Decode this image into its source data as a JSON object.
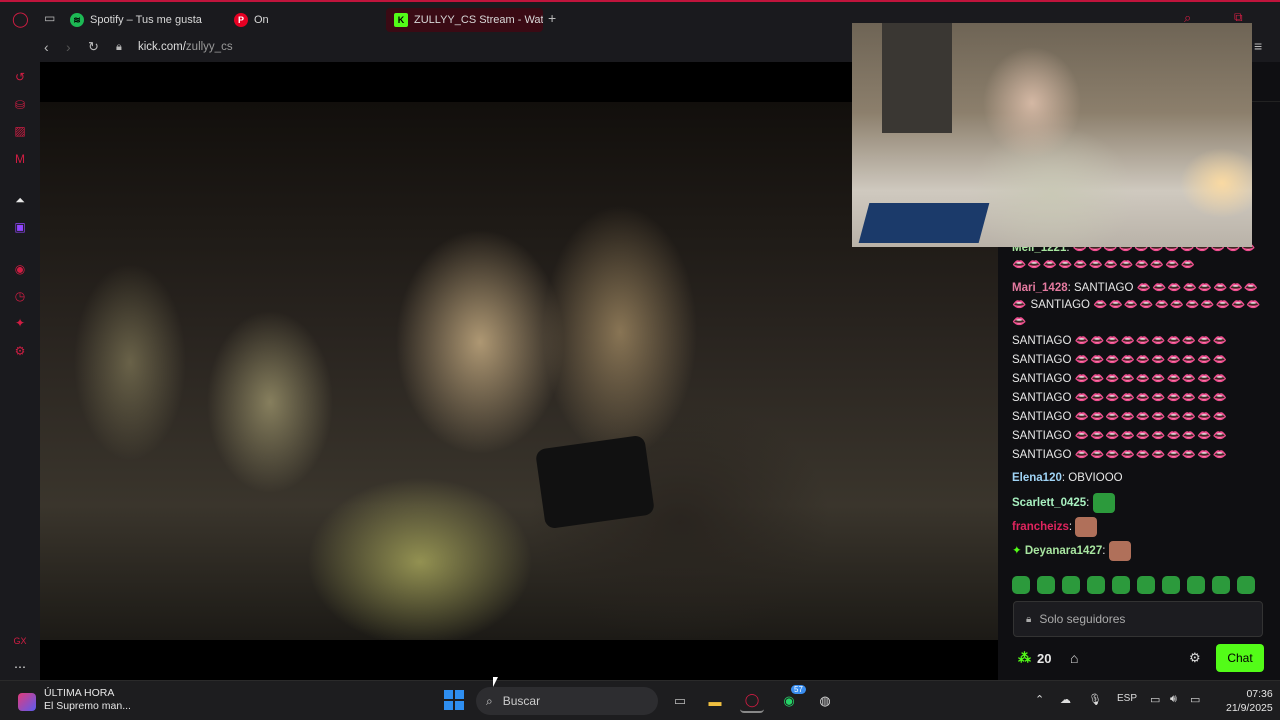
{
  "browser": {
    "tabs": [
      {
        "label": "Spotify – Tus me gusta",
        "icon": "spotify-icon",
        "color": "#1db954"
      },
      {
        "label": "On",
        "icon": "pinterest-icon",
        "color": "#e60023"
      },
      {
        "label": "ZULLYY_CS Stream - Wat",
        "icon": "kick-icon",
        "color": "#53fc18"
      }
    ],
    "new_tab": "+",
    "url_host": "kick.com/",
    "url_path": "zullyy_cs"
  },
  "chat": {
    "messages": [
      {
        "user": "Meli_1221",
        "color": "#a8e6a0",
        "text": "",
        "lips": "👄👄👄👄👄👄👄👄👄👄👄👄👄👄👄👄👄👄👄👄👄👄👄👄"
      },
      {
        "user": "Mari_1428",
        "color": "#e57aa0",
        "text": "SANTIAGO",
        "lips": "👄👄👄👄👄👄👄👄 👄"
      },
      {
        "user": "",
        "color": "#e8e8e8",
        "text": "SANTIAGO",
        "lips": "👄👄👄👄👄👄👄👄👄👄👄👄"
      },
      {
        "user": "",
        "color": "#e8e8e8",
        "text": "SANTIAGO",
        "lips": "👄👄👄👄👄👄👄👄👄👄"
      },
      {
        "user": "",
        "color": "#e8e8e8",
        "text": "SANTIAGO",
        "lips": "👄👄👄👄👄👄👄👄👄👄"
      },
      {
        "user": "",
        "color": "#e8e8e8",
        "text": "SANTIAGO",
        "lips": "👄👄👄👄👄👄👄👄👄👄"
      },
      {
        "user": "",
        "color": "#e8e8e8",
        "text": "SANTIAGO",
        "lips": "👄👄👄👄👄👄👄👄👄👄"
      },
      {
        "user": "",
        "color": "#e8e8e8",
        "text": "SANTIAGO",
        "lips": "👄👄👄👄👄👄👄👄👄👄"
      },
      {
        "user": "",
        "color": "#e8e8e8",
        "text": "SANTIAGO",
        "lips": "👄👄👄👄👄👄👄👄👄👄"
      },
      {
        "user": "",
        "color": "#e8e8e8",
        "text": "SANTIAGO",
        "lips": "👄👄👄👄👄👄👄👄👄👄"
      },
      {
        "user": "Elena120",
        "color": "#9fd3f5",
        "text": "OBVIOOO",
        "lips": ""
      },
      {
        "user": "Scarlett_0425",
        "color": "#a8f0c0",
        "text": "",
        "lips": ""
      },
      {
        "user": "francheizs",
        "color": "#e0245e",
        "text": "",
        "lips": ""
      },
      {
        "user": "Deyanara1427",
        "color": "#a8e6a0",
        "text": "",
        "lips": ""
      }
    ],
    "input_placeholder": "Solo seguidores",
    "points": "20",
    "send_label": "Chat"
  },
  "taskbar": {
    "news_title": "ÚLTIMA HORA",
    "news_sub": "El Supremo man...",
    "search_placeholder": "Buscar",
    "whatsapp_badge": "57",
    "lang": "ESP",
    "time": "07:36",
    "date": "21/9/2025"
  },
  "colors": {
    "accent": "#c0143c",
    "kick_green": "#53fc18"
  }
}
